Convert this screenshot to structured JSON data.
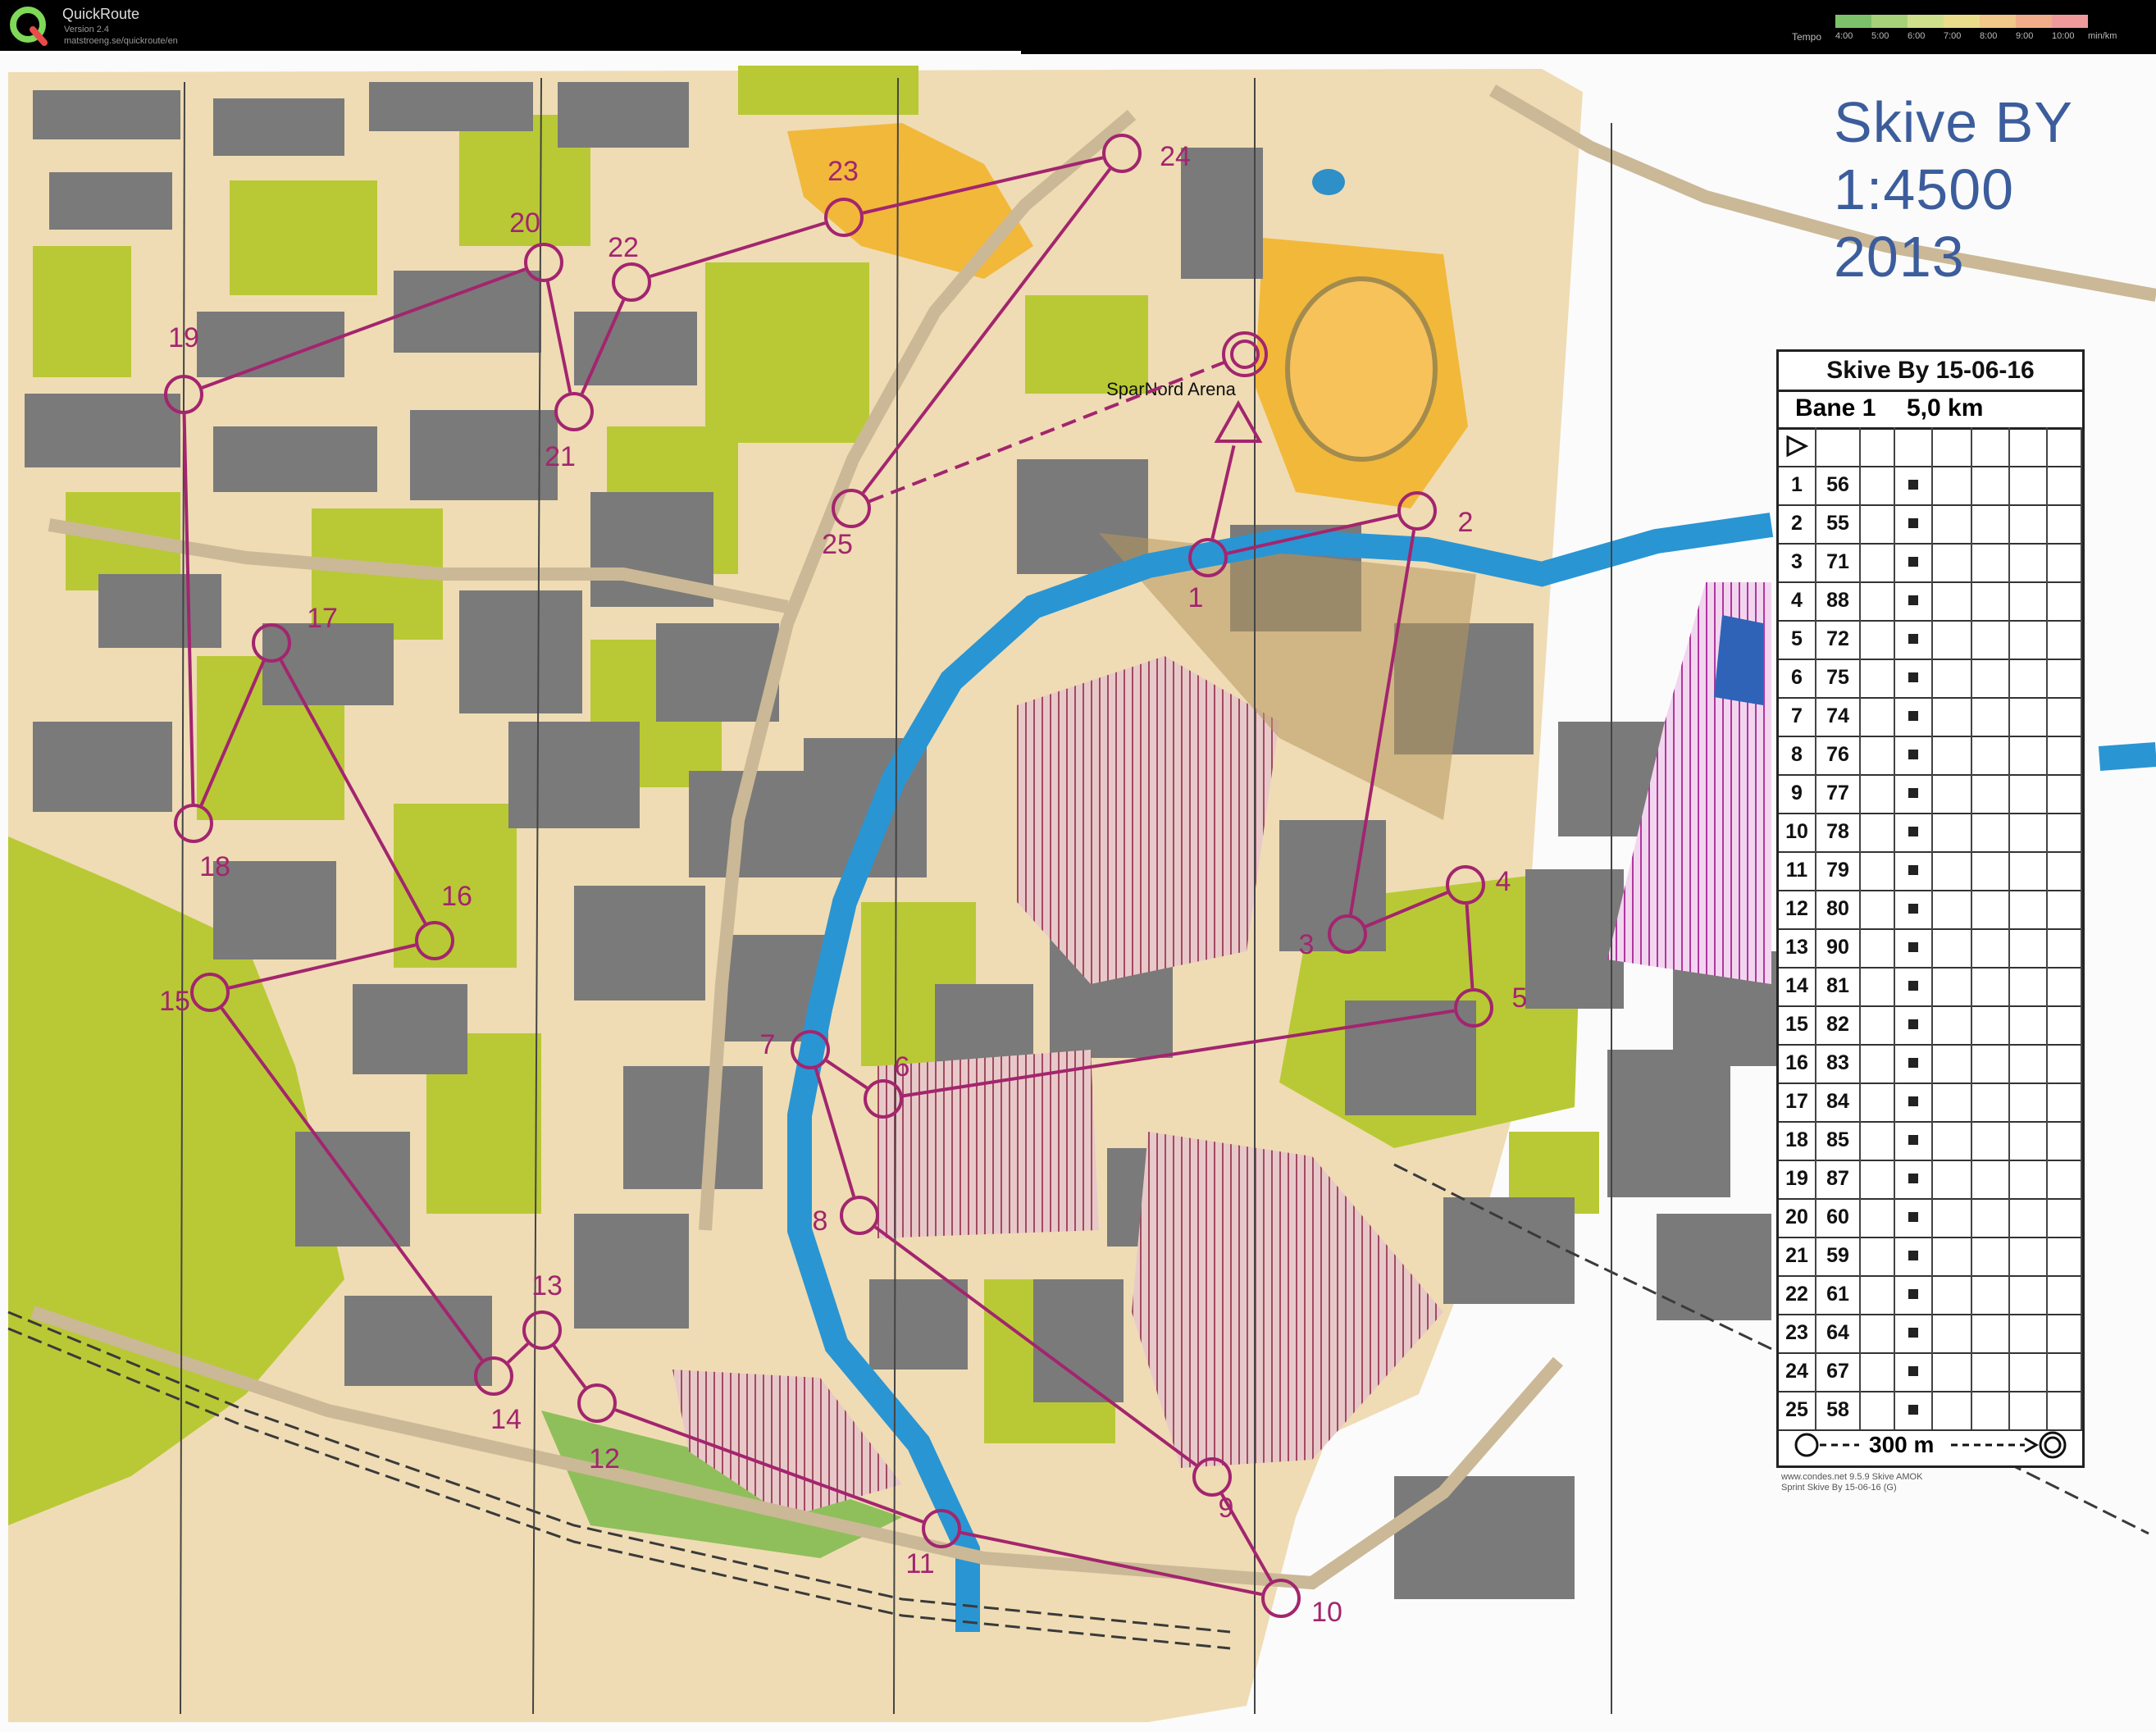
{
  "app": {
    "name": "QuickRoute",
    "version": "Version 2.4",
    "url": "matstroeng.se/quickroute/en",
    "tempo_label": "Tempo",
    "tempo_ticks": [
      "4:00",
      "5:00",
      "6:00",
      "7:00",
      "8:00",
      "9:00",
      "10:00",
      "min/km"
    ],
    "tempo_colors": [
      "#7cc26a",
      "#a6d27a",
      "#cfe08c",
      "#e9dd8c",
      "#f2c78a",
      "#f1ad8a",
      "#ef9b9b"
    ]
  },
  "map": {
    "title_lines": [
      "Skive BY",
      "1:4500",
      "2013"
    ],
    "start_label": "SparNord Arena",
    "controls": [
      {
        "n": "1"
      },
      {
        "n": "2"
      },
      {
        "n": "3"
      },
      {
        "n": "4"
      },
      {
        "n": "5"
      },
      {
        "n": "6"
      },
      {
        "n": "7"
      },
      {
        "n": "8"
      },
      {
        "n": "9"
      },
      {
        "n": "10"
      },
      {
        "n": "11"
      },
      {
        "n": "12"
      },
      {
        "n": "13"
      },
      {
        "n": "14"
      },
      {
        "n": "15"
      },
      {
        "n": "16"
      },
      {
        "n": "17"
      },
      {
        "n": "18"
      },
      {
        "n": "19"
      },
      {
        "n": "20"
      },
      {
        "n": "21"
      },
      {
        "n": "22"
      },
      {
        "n": "23"
      },
      {
        "n": "24"
      },
      {
        "n": "25"
      }
    ]
  },
  "description_sheet": {
    "event": "Skive By 15-06-16",
    "course": "Bane 1",
    "length": "5,0 km",
    "rows": [
      {
        "num": "1",
        "code": "56"
      },
      {
        "num": "2",
        "code": "55"
      },
      {
        "num": "3",
        "code": "71"
      },
      {
        "num": "4",
        "code": "88"
      },
      {
        "num": "5",
        "code": "72"
      },
      {
        "num": "6",
        "code": "75"
      },
      {
        "num": "7",
        "code": "74"
      },
      {
        "num": "8",
        "code": "76"
      },
      {
        "num": "9",
        "code": "77"
      },
      {
        "num": "10",
        "code": "78"
      },
      {
        "num": "11",
        "code": "79"
      },
      {
        "num": "12",
        "code": "80"
      },
      {
        "num": "13",
        "code": "90"
      },
      {
        "num": "14",
        "code": "81"
      },
      {
        "num": "15",
        "code": "82"
      },
      {
        "num": "16",
        "code": "83"
      },
      {
        "num": "17",
        "code": "84"
      },
      {
        "num": "18",
        "code": "85"
      },
      {
        "num": "19",
        "code": "87"
      },
      {
        "num": "20",
        "code": "60"
      },
      {
        "num": "21",
        "code": "59"
      },
      {
        "num": "22",
        "code": "61"
      },
      {
        "num": "23",
        "code": "64"
      },
      {
        "num": "24",
        "code": "67"
      },
      {
        "num": "25",
        "code": "58"
      }
    ],
    "finish": "300 m",
    "imprint": [
      "www.condes.net 9.5.9 Skive AMOK",
      "Sprint Skive By 15-06-16 (G)"
    ]
  }
}
